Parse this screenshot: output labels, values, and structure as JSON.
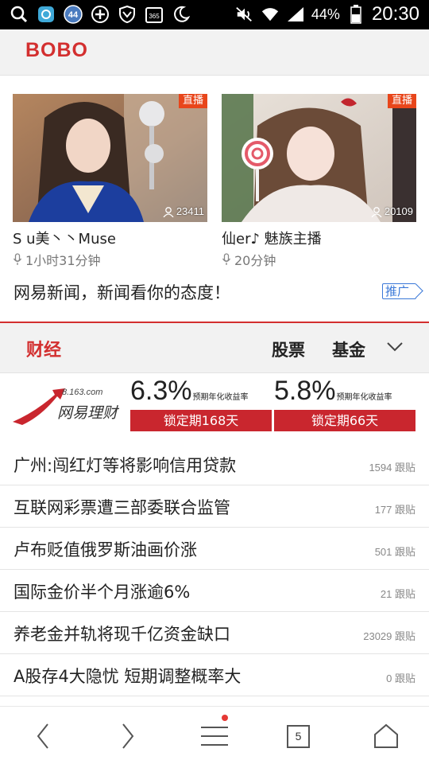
{
  "status_bar": {
    "icons_left": [
      "search-icon",
      "camera-app-icon",
      "badge-44-icon",
      "plus-circle-icon",
      "shield-icon",
      "calendar-365-icon",
      "moon-icon"
    ],
    "badge_number": "44",
    "calendar_label": "365",
    "icons_right": [
      "mute-icon",
      "wifi-icon",
      "signal-icon",
      "battery-icon"
    ],
    "battery": "44%",
    "time": "20:30"
  },
  "bobo": {
    "title": "BOBO",
    "cards": [
      {
        "badge": "直播",
        "viewers": "23411",
        "title": "S u美丶丶Muse",
        "duration": "1小时31分钟"
      },
      {
        "badge": "直播",
        "viewers": "20109",
        "title": "仙er♪ 魅族主播",
        "duration": "20分钟"
      }
    ]
  },
  "promo": {
    "text": "网易新闻，新闻看你的态度！",
    "tag": "推广"
  },
  "finance": {
    "title": "财经",
    "tabs": [
      "股票",
      "基金"
    ],
    "ad": {
      "domain": "8.163.com",
      "brand": "网易理财",
      "products": [
        {
          "rate": "6.3%",
          "note": "预期年化收益率",
          "button": "锁定期168天"
        },
        {
          "rate": "5.8%",
          "note": "预期年化收益率",
          "button": "锁定期66天"
        }
      ]
    },
    "news": [
      {
        "title": "广州:闯红灯等将影响信用贷款",
        "count": "1594 跟贴"
      },
      {
        "title": "互联网彩票遭三部委联合监管",
        "count": "177 跟贴"
      },
      {
        "title": "卢布贬值俄罗斯油画价涨",
        "count": "501 跟贴"
      },
      {
        "title": "国际金价半个月涨逾6%",
        "count": "21 跟贴"
      },
      {
        "title": "养老金并轨将现千亿资金缺口",
        "count": "23029 跟贴"
      },
      {
        "title": "A股存4大隐忧 短期调整概率大",
        "count": "0 跟贴"
      }
    ]
  },
  "bottom_nav": {
    "tab_count": "5",
    "icons": [
      "back-icon",
      "forward-icon",
      "menu-icon",
      "tabs-icon",
      "home-icon"
    ]
  },
  "colors": {
    "accent_red": "#d32f2f",
    "button_red": "#c9262e",
    "live_badge": "#e8461b",
    "promo_blue": "#3a78d8"
  }
}
